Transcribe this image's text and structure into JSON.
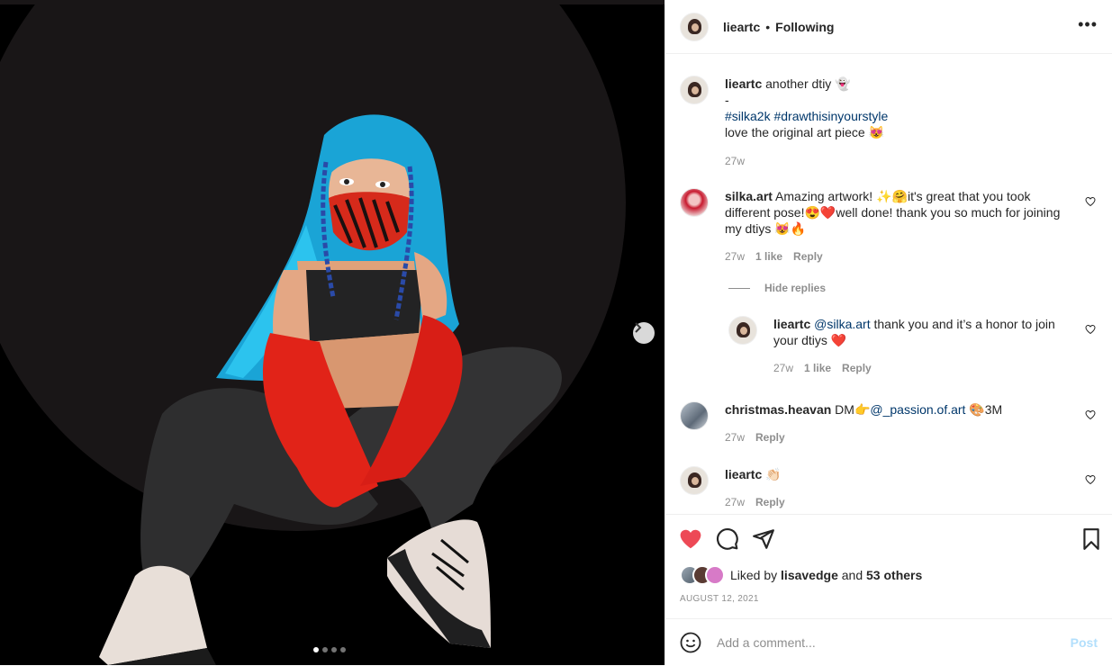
{
  "post": {
    "author": "lieartc",
    "separator": "•",
    "follow_status": "Following",
    "more_label": "•••",
    "image_index": 1,
    "image_count": 4
  },
  "caption": {
    "user": "lieartc",
    "line1": " another dtiy 👻",
    "line2": "-",
    "tag1": "#silka2k",
    "tag2": "#drawthisinyourstyle",
    "line4": "love the original art piece 😻",
    "time": "27w"
  },
  "comments": [
    {
      "user": "silka.art",
      "text": " Amazing artwork! ✨🤗it's great that you took different pose!😍❤️well done! thank you so much for joining my dtiys 😻🔥",
      "time": "27w",
      "likes": "1 like",
      "reply": "Reply"
    },
    {
      "hide_replies": "Hide replies"
    },
    {
      "user": "lieartc",
      "mention": "@silka.art",
      "text": " thank you and it’s a honor to join your dtiys ❤️",
      "time": "27w",
      "likes": "1 like",
      "reply": "Reply"
    },
    {
      "user": "christmas.heavan",
      "text_pre": " DM👉",
      "mention": "@_passion.of.art",
      "text_post": " 🎨3M",
      "time": "27w",
      "reply": "Reply"
    },
    {
      "user": "lieartc",
      "text": " 👏🏻",
      "time": "27w",
      "reply": "Reply"
    }
  ],
  "likes": {
    "prefix": "Liked by ",
    "user": "lisavedge",
    "and": " and ",
    "others": "53 others"
  },
  "date": "AUGUST 12, 2021",
  "add_comment": {
    "placeholder": "Add a comment...",
    "post_label": "Post"
  },
  "colors": {
    "like_red": "#ed4956",
    "link_blue": "#00376b",
    "post_disabled": "#b2dffc"
  }
}
